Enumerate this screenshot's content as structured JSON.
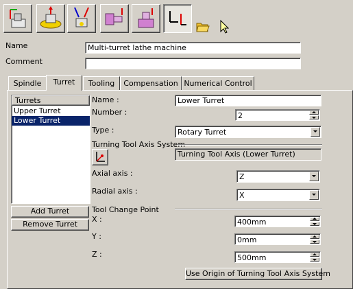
{
  "toolbar": {
    "items": [
      {
        "icon": "machine-setup-icon"
      },
      {
        "icon": "rotary-table-icon"
      },
      {
        "icon": "multi-axis-head-icon"
      },
      {
        "icon": "spindle-icon"
      },
      {
        "icon": "turret-icon"
      },
      {
        "icon": "tool-axis-icon",
        "pressed": true
      },
      {
        "icon": "open-folder-icon"
      },
      {
        "icon": "select-arrow-icon"
      }
    ]
  },
  "header": {
    "name_label": "Name",
    "name_value": "Multi-turret lathe machine",
    "comment_label": "Comment",
    "comment_value": ""
  },
  "tabs": [
    {
      "label": "Spindle"
    },
    {
      "label": "Turret",
      "active": true
    },
    {
      "label": "Tooling"
    },
    {
      "label": "Compensation"
    },
    {
      "label": "Numerical Control"
    }
  ],
  "turret_list": {
    "header": "Turrets",
    "items": [
      "Upper Turret",
      "Lower Turret"
    ],
    "selected": "Lower Turret",
    "add_button": "Add Turret",
    "remove_button": "Remove Turret"
  },
  "form": {
    "name_label": "Name :",
    "name_value": "Lower Turret",
    "number_label": "Number :",
    "number_value": "2",
    "type_label": "Type :",
    "type_value": "Rotary Turret",
    "axis_system_label": "Turning Tool Axis System",
    "axis_system_value": "Turning Tool Axis (Lower Turret)",
    "axial_label": "Axial axis :",
    "axial_value": "Z",
    "radial_label": "Radial axis :",
    "radial_value": "X",
    "tool_change_label": "Tool Change Point",
    "x_label": "X :",
    "x_value": "400mm",
    "y_label": "Y :",
    "y_value": "0mm",
    "z_label": "Z :",
    "z_value": "500mm",
    "use_origin_button": "Use Origin of Turning Tool Axis System"
  }
}
